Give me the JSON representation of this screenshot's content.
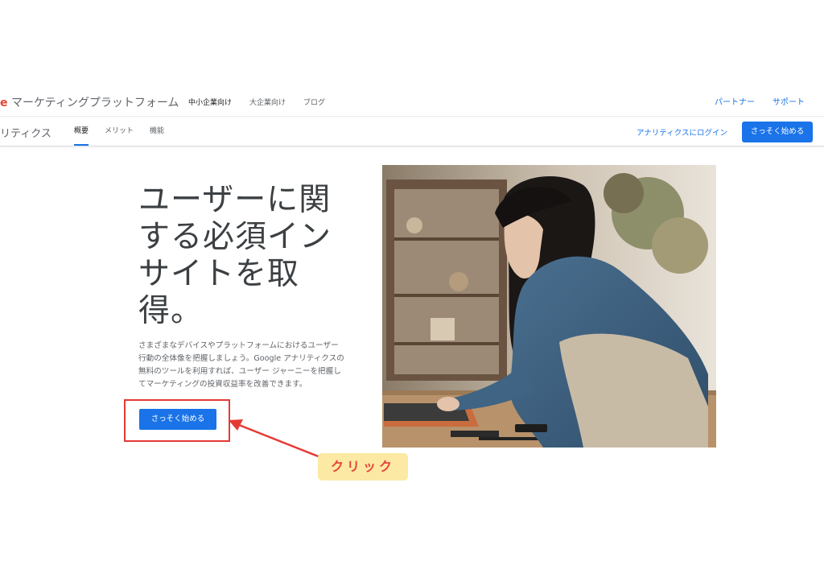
{
  "brand": {
    "prefix": "e",
    "name": "マーケティングプラットフォーム"
  },
  "top_nav": [
    "中小企業向け",
    "大企業向け",
    "ブログ"
  ],
  "top_right": [
    "パートナー",
    "サポート"
  ],
  "product": {
    "name": "リティクス"
  },
  "tabs": [
    "概要",
    "メリット",
    "機能"
  ],
  "login_link": "アナリティクスにログイン",
  "start_button": "さっそく始める",
  "hero": {
    "headline_lines": [
      "ユーザーに関",
      "する必須イン",
      "サイトを取",
      "得。"
    ],
    "body_lines": [
      "さまざまなデバイスやプラットフォームにおけるユーザー",
      "行動の全体像を把握しましょう。Google アナリティクスの",
      "無料のツールを利用すれば、ユーザー ジャーニーを把握し",
      "てマーケティングの投資収益率を改善できます。"
    ],
    "cta": "さっそく始める"
  },
  "annotation": {
    "label": "クリック",
    "color": "#e53935"
  },
  "colors": {
    "accent": "#1a73e8",
    "annotation_bg": "#fce9a4"
  }
}
